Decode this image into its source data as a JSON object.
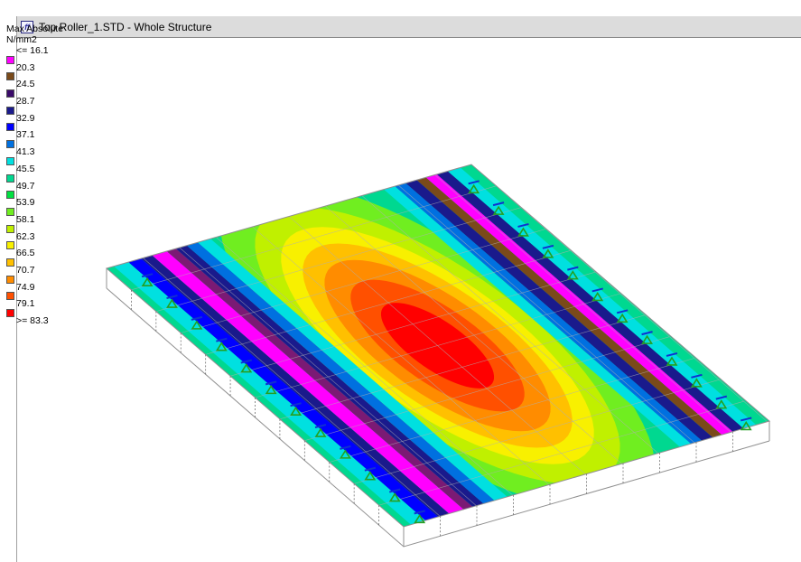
{
  "window": {
    "title": "Top Roller_1.STD - Whole Structure",
    "icon": "staad-app-icon"
  },
  "legend": {
    "title": "Max Absolute",
    "unit": "N/mm2",
    "items": [
      {
        "label": "<= 16.1",
        "color": "#7b1a74"
      },
      {
        "label": "20.3",
        "color": "#ff00ff"
      },
      {
        "label": "24.5",
        "color": "#7a4a1a"
      },
      {
        "label": "28.7",
        "color": "#3a0a6a"
      },
      {
        "label": "32.9",
        "color": "#1a1a8c"
      },
      {
        "label": "37.1",
        "color": "#0000ff"
      },
      {
        "label": "41.3",
        "color": "#0070e0"
      },
      {
        "label": "45.5",
        "color": "#00e0e0"
      },
      {
        "label": "49.7",
        "color": "#00d890"
      },
      {
        "label": "53.9",
        "color": "#00e040"
      },
      {
        "label": "58.1",
        "color": "#70ee20"
      },
      {
        "label": "62.3",
        "color": "#c0f000"
      },
      {
        "label": "66.5",
        "color": "#f8f000"
      },
      {
        "label": "70.7",
        "color": "#ffc000"
      },
      {
        "label": "74.9",
        "color": "#ff8c00"
      },
      {
        "label": "79.1",
        "color": "#ff5000"
      },
      {
        "label": ">= 83.3",
        "color": "#ff0000"
      }
    ]
  },
  "colors": {
    "mesh_line": "#b0b0b0",
    "support_green": "#22a022",
    "support_blue": "#1030d0"
  }
}
